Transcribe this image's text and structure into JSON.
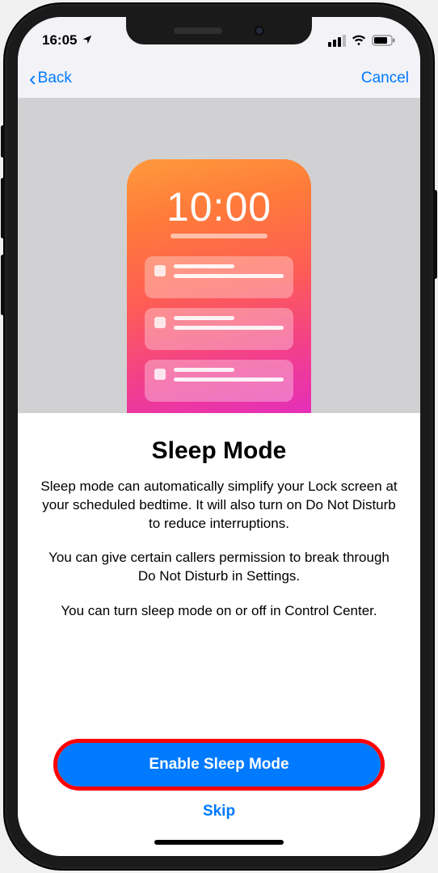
{
  "status": {
    "time": "16:05",
    "location_icon": "location-arrow"
  },
  "nav": {
    "back_label": "Back",
    "cancel_label": "Cancel"
  },
  "illustration": {
    "clock_time": "10:00"
  },
  "content": {
    "title": "Sleep Mode",
    "p1": "Sleep mode can automatically simplify your Lock screen at your scheduled bedtime. It will also turn on Do Not Disturb to reduce interruptions.",
    "p2": "You can give certain callers permission to break through Do Not Disturb in Settings.",
    "p3": "You can turn sleep mode on or off in Control Center."
  },
  "actions": {
    "primary_label": "Enable Sleep Mode",
    "skip_label": "Skip"
  }
}
